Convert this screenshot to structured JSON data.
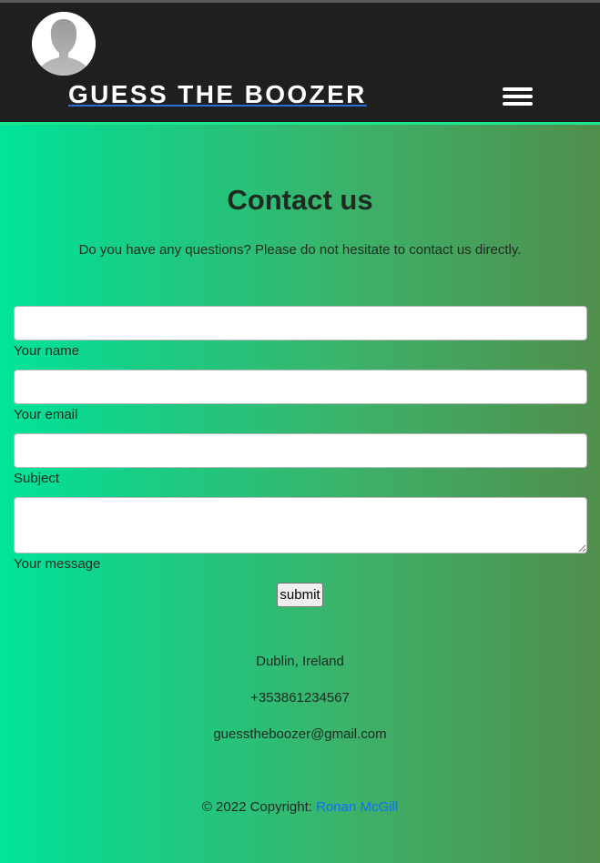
{
  "header": {
    "brand": "GUESS THE BOOZER",
    "menu_icon": "hamburger-menu-icon",
    "avatar_icon": "user-avatar-icon"
  },
  "main": {
    "title": "Contact us",
    "intro": "Do you have any questions? Please do not hesitate to contact us directly."
  },
  "form": {
    "name": {
      "label": "Your name",
      "value": ""
    },
    "email": {
      "label": "Your email",
      "value": ""
    },
    "subject": {
      "label": "Subject",
      "value": ""
    },
    "message": {
      "label": "Your message",
      "value": ""
    },
    "submit_label": "submit"
  },
  "contact": {
    "location": "Dublin, Ireland",
    "phone": "+353861234567",
    "email": "guesstheboozer@gmail.com"
  },
  "footer": {
    "copyright": "© 2022 Copyright: ",
    "author": "Ronan McGill"
  },
  "colors": {
    "header_bg": "#1f1f1f",
    "header_border": "#1ee68c",
    "gradient_start": "#00e59a",
    "gradient_end": "#508e4c",
    "link": "#0d6efd"
  }
}
